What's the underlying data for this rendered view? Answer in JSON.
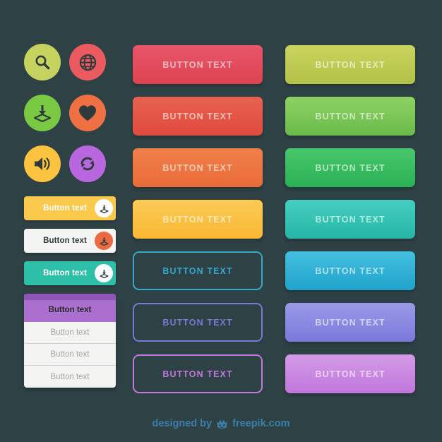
{
  "theme": {
    "background": "#2e4144",
    "footer_text_color": "#3d7fa8"
  },
  "icon_circles": [
    {
      "name": "search-icon",
      "icon": "magnifier",
      "circle_color": "#c6d45f",
      "glyph_color": "#2f3a3c"
    },
    {
      "name": "globe-icon",
      "icon": "globe",
      "circle_color": "#ea5a5f",
      "glyph_color": "#2f3a3c"
    },
    {
      "name": "download-icon",
      "icon": "download",
      "circle_color": "#7ac943",
      "glyph_color": "#2f3a3c"
    },
    {
      "name": "heart-icon",
      "icon": "heart",
      "circle_color": "#ef7043",
      "glyph_color": "#2f3a3c"
    },
    {
      "name": "volume-icon",
      "icon": "volume",
      "circle_color": "#fbc33e",
      "glyph_color": "#2f3a3c"
    },
    {
      "name": "refresh-icon",
      "icon": "refresh",
      "circle_color": "#b967de",
      "glyph_color": "#2f3a3c"
    }
  ],
  "small_buttons": [
    {
      "label": "Button text",
      "style": "sb-yellow",
      "badge_icon": "download-icon"
    },
    {
      "label": "Button text",
      "style": "sb-white",
      "badge_icon": "download-icon"
    },
    {
      "label": "Button text",
      "style": "sb-teal",
      "badge_icon": "download-icon"
    }
  ],
  "dropdown": {
    "header_label": "Button text",
    "header_color": "#ab6fd0",
    "header_top_strip_color": "#9055b9",
    "items": [
      {
        "label": "Button text"
      },
      {
        "label": "Button text"
      },
      {
        "label": "Button text"
      }
    ]
  },
  "middle_buttons": [
    {
      "label": "BUTTON TEXT",
      "type": "filled",
      "gradient_top": "#e8566b",
      "gradient_bottom": "#dd4351"
    },
    {
      "label": "BUTTON TEXT",
      "type": "filled",
      "gradient_top": "#e8624f",
      "gradient_bottom": "#e04a3e"
    },
    {
      "label": "BUTTON TEXT",
      "type": "filled",
      "gradient_top": "#f08049",
      "gradient_bottom": "#ea6b39"
    },
    {
      "label": "BUTTON TEXT",
      "type": "filled",
      "gradient_top": "#fccb55",
      "gradient_bottom": "#f9b733"
    },
    {
      "label": "BUTTON TEXT",
      "type": "outline",
      "border_color": "#35a8cf",
      "text_color": "#35a8cf"
    },
    {
      "label": "BUTTON TEXT",
      "type": "outline",
      "border_color": "#7b79d6",
      "text_color": "#7b79d6"
    },
    {
      "label": "BUTTON TEXT",
      "type": "outline",
      "border_color": "#c079dc",
      "text_color": "#c079dc"
    }
  ],
  "right_buttons": [
    {
      "label": "BUTTON TEXT",
      "type": "filled",
      "gradient_top": "#c9d45d",
      "gradient_bottom": "#b3c248"
    },
    {
      "label": "BUTTON TEXT",
      "type": "filled",
      "gradient_top": "#8ed165",
      "gradient_bottom": "#69bb49"
    },
    {
      "label": "BUTTON TEXT",
      "type": "filled",
      "gradient_top": "#49c76c",
      "gradient_bottom": "#2bb055"
    },
    {
      "label": "BUTTON TEXT",
      "type": "filled",
      "gradient_top": "#46cfc0",
      "gradient_bottom": "#25b6a6"
    },
    {
      "label": "BUTTON TEXT",
      "type": "filled",
      "gradient_top": "#45bfdf",
      "gradient_bottom": "#1fa3cc"
    },
    {
      "label": "BUTTON TEXT",
      "type": "filled",
      "gradient_top": "#9b9ae8",
      "gradient_bottom": "#7a79dc"
    },
    {
      "label": "BUTTON TEXT",
      "type": "filled",
      "gradient_top": "#d49ae6",
      "gradient_bottom": "#c077dd"
    }
  ],
  "footer": {
    "prefix": "designed by",
    "brand": "freepik.com",
    "logo_icon": "freepik-crown-icon"
  }
}
